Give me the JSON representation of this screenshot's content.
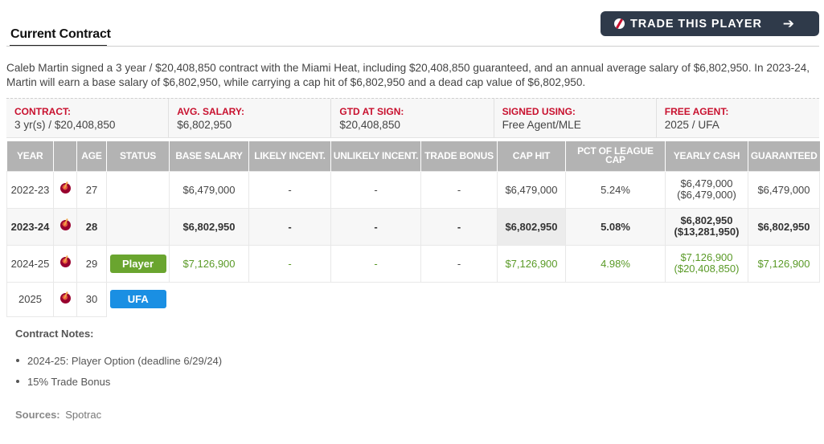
{
  "header": {
    "section_title": "Current Contract",
    "trade_button_label": "TRADE THIS PLAYER",
    "trade_button_icon": "basketball-icon",
    "trade_button_arrow_icon": "arrow-right-icon"
  },
  "summary": "Caleb Martin signed a 3 year / $20,408,850 contract with the Miami Heat, including $20,408,850 guaranteed, and an annual average salary of $6,802,950. In 2023-24, Martin will earn a base salary of $6,802,950, while carrying a cap hit of $6,802,950 and a dead cap value of $6,802,950.",
  "terms": [
    {
      "label": "CONTRACT:",
      "value": "3 yr(s) / $20,408,850"
    },
    {
      "label": "AVG. SALARY:",
      "value": "$6,802,950"
    },
    {
      "label": "GTD AT SIGN:",
      "value": "$20,408,850"
    },
    {
      "label": "SIGNED USING:",
      "value": "Free Agent/MLE"
    },
    {
      "label": "FREE AGENT:",
      "value": "2025 / UFA"
    }
  ],
  "table": {
    "columns": [
      "YEAR",
      "",
      "AGE",
      "STATUS",
      "BASE SALARY",
      "LIKELY INCENT.",
      "UNLIKELY INCENT.",
      "TRADE BONUS",
      "CAP HIT",
      "PCT OF LEAGUE CAP",
      "YEARLY CASH",
      "GUARANTEED"
    ],
    "team_logo_icon": "miami-heat-logo-icon",
    "rows": [
      {
        "year": "2022-23",
        "age": "27",
        "status": "",
        "base_salary": "$6,479,000",
        "likely": "-",
        "unlikely": "-",
        "trade_bonus": "-",
        "cap_hit": "$6,479,000",
        "pct_cap": "5.24%",
        "yearly_cash": "$6,479,000",
        "cumulative_cash": "($6,479,000)",
        "guaranteed": "$6,479,000"
      },
      {
        "year": "2023-24",
        "age": "28",
        "status": "",
        "base_salary": "$6,802,950",
        "likely": "-",
        "unlikely": "-",
        "trade_bonus": "-",
        "cap_hit": "$6,802,950",
        "pct_cap": "5.08%",
        "yearly_cash": "$6,802,950",
        "cumulative_cash": "($13,281,950)",
        "guaranteed": "$6,802,950"
      },
      {
        "year": "2024-25",
        "age": "29",
        "status": "Player",
        "base_salary": "$7,126,900",
        "likely": "-",
        "unlikely": "-",
        "trade_bonus": "-",
        "cap_hit": "$7,126,900",
        "pct_cap": "4.98%",
        "yearly_cash": "$7,126,900",
        "cumulative_cash": "($20,408,850)",
        "guaranteed": "$7,126,900"
      },
      {
        "year": "2025",
        "age": "30",
        "status": "UFA"
      }
    ]
  },
  "colors": {
    "accent_red": "#c8102e",
    "player_option_green": "#6aa52f",
    "ufa_blue": "#1a8fe3",
    "button_dark": "#2f3a4a",
    "header_gray": "#b3b3b3"
  },
  "notes": {
    "title": "Contract Notes:",
    "items": [
      "2024-25: Player Option (deadline 6/29/24)",
      "15% Trade Bonus"
    ]
  },
  "sources": {
    "label": "Sources:",
    "value": "Spotrac"
  }
}
